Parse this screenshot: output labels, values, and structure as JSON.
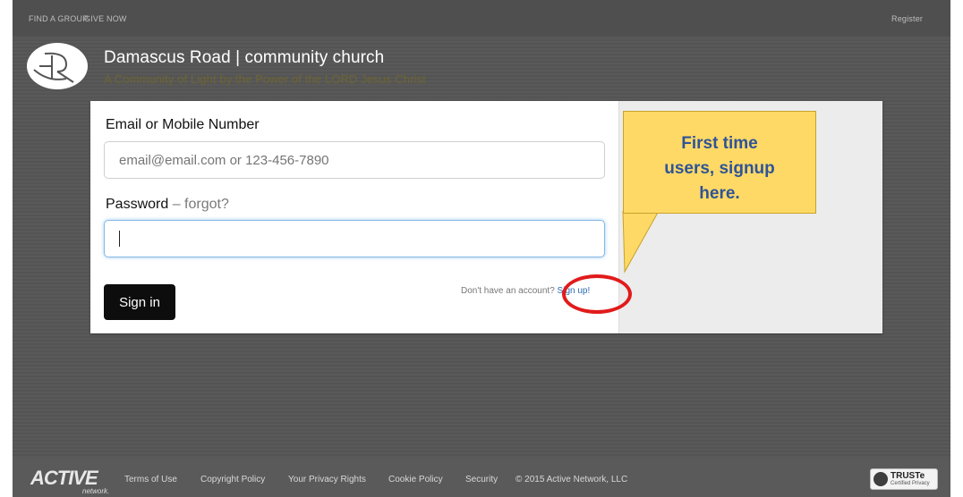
{
  "topnav": {
    "find_group": "FIND A GROUP",
    "give_now": "GIVE NOW",
    "register": "Register"
  },
  "brand": {
    "logo_icon": "dr-monogram-icon",
    "title": "Damascus Road | community church",
    "tagline": "A Community of Light by the Power of the LORD Jesus Christ"
  },
  "login": {
    "email_label": "Email or Mobile Number",
    "email_placeholder": "email@email.com or 123-456-7890",
    "password_label": "Password",
    "password_separator": " – ",
    "forgot_link": "forgot?",
    "password_value": "",
    "signin_button": "Sign in",
    "no_account_text": "Don't have an account?",
    "signup_link": "Sign up!"
  },
  "callout": {
    "line1": "First time",
    "line2": "users, signup",
    "line3": "here."
  },
  "footer": {
    "logo_text": "ACTIVE",
    "logo_sub": "network.",
    "links": [
      "Terms of Use",
      "Copyright Policy",
      "Your Privacy Rights",
      "Cookie Policy",
      "Security"
    ],
    "copyright": "© 2015 Active Network, LLC",
    "truste_title": "TRUSTe",
    "truste_sub": "Certified Privacy"
  },
  "colors": {
    "background": "#565656",
    "tagline": "#6d6431",
    "callout_fill": "#ffd966",
    "callout_text": "#2f5496",
    "highlight_circle": "#e11b1b",
    "signup_link": "#2b6cb0"
  }
}
